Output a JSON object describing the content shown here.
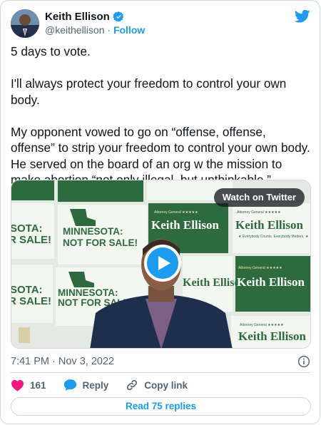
{
  "author": {
    "name": "Keith Ellison",
    "handle": "@keithellison",
    "separator": "·",
    "follow_label": "Follow"
  },
  "tweet": {
    "text": "5 days to vote.\n\nI'll always protect your freedom to control your own body.\n\nMy opponent vowed to go on “offense, offense, offense” to strip your freedom to control your own body. He served on the board of an org w the mission to make abortion “not only illegal, but unthinkable.”"
  },
  "media": {
    "watch_label": "Watch on Twitter",
    "signs": {
      "mn_line1": "MINNESOTA:",
      "mn_line2": "NOT FOR SALE!",
      "mn_partial_line1": "SOTA:",
      "mn_partial_line2": "R SALE!",
      "ke_top": "Attorney General ★★★★★",
      "ke_name": "Keith Ellison",
      "ke_sub": "★ Everybody Counts. Everybody Matters. ★"
    }
  },
  "meta": {
    "timestamp": "7:41 PM · Nov 3, 2022"
  },
  "actions": {
    "like_count": "161",
    "reply_label": "Reply",
    "copy_label": "Copy link"
  },
  "read_replies_label": "Read 75 replies",
  "colors": {
    "accent": "#1d9bf0",
    "like": "#f91880",
    "muted": "#536471",
    "border": "#cfd9de",
    "sign_green": "#2d6a3e"
  }
}
